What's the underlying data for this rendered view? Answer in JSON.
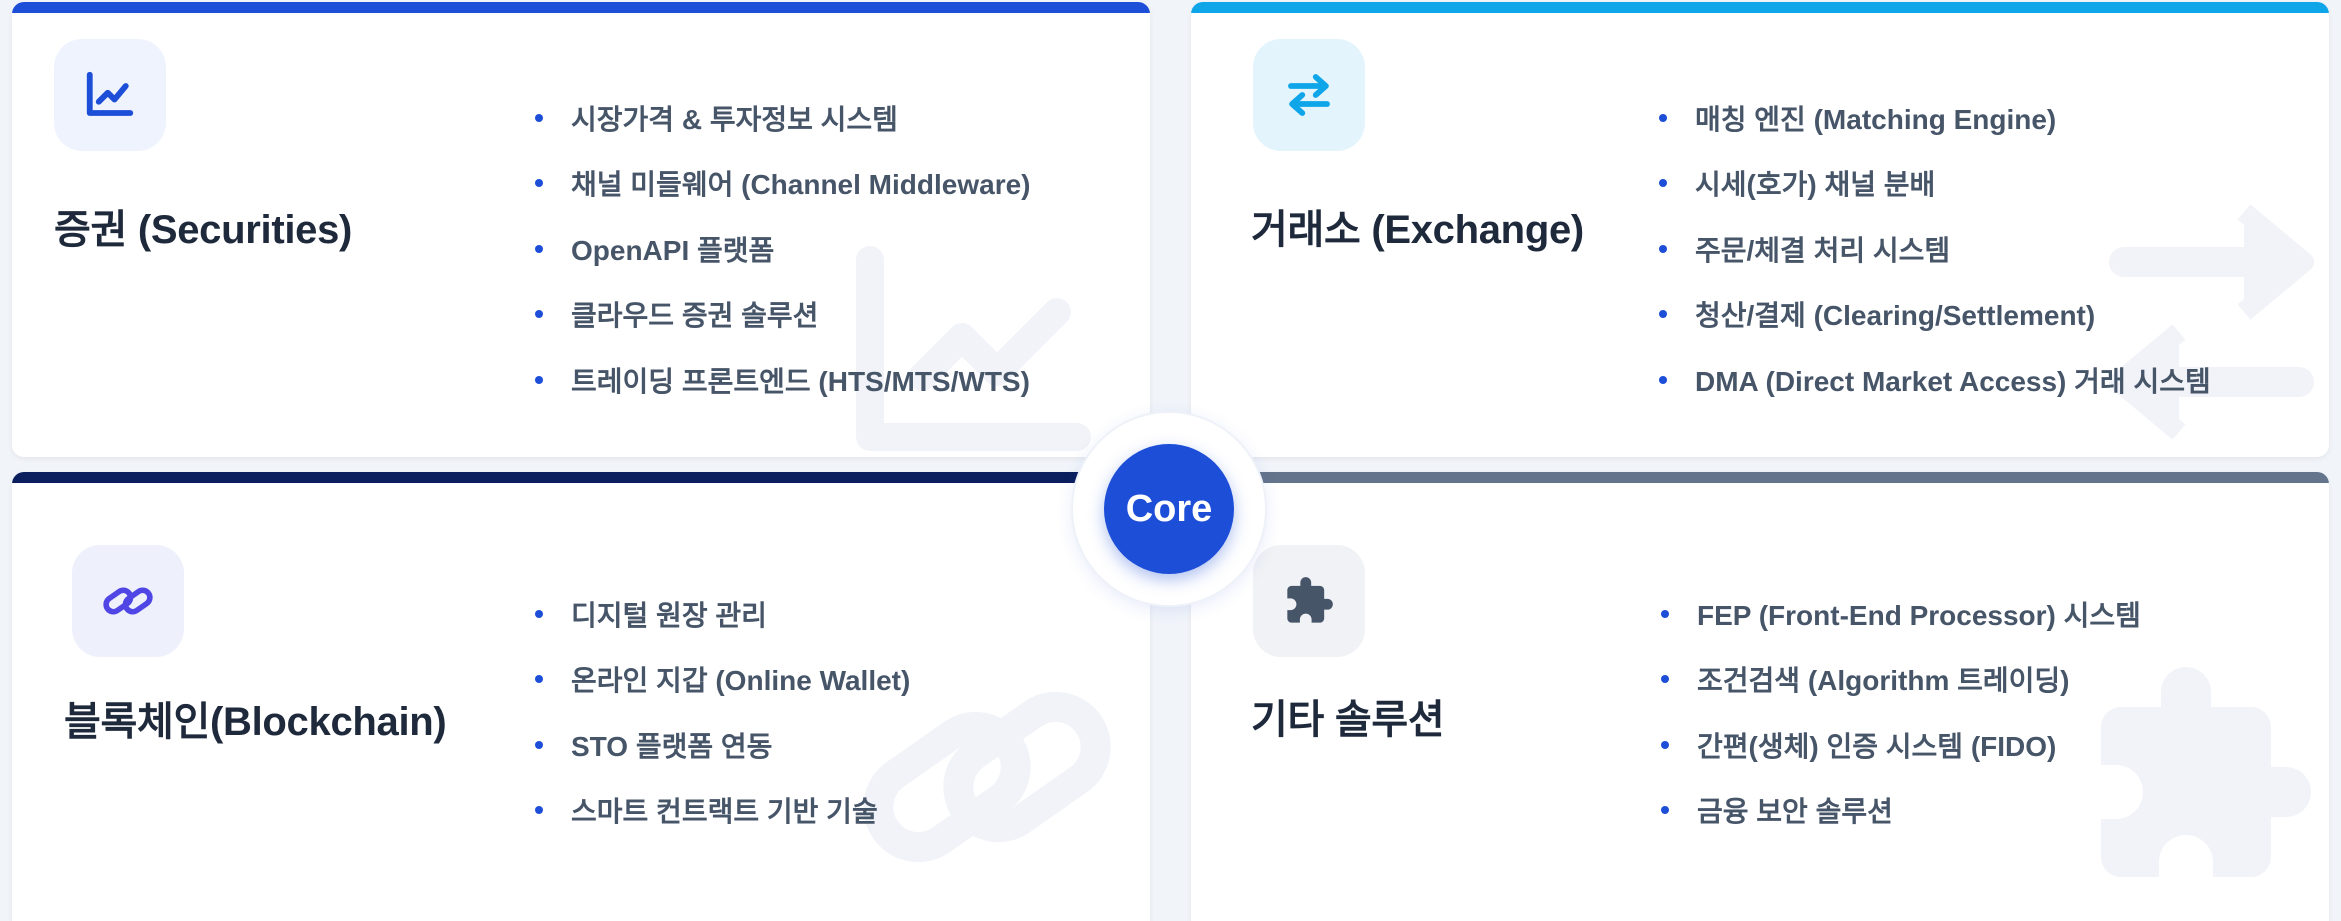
{
  "colors": {
    "securities_accent": "#1d4ed8",
    "exchange_accent": "#0ea5e9",
    "blockchain_accent": "#0b1f5e",
    "other_accent": "#64748b",
    "core_badge": "#1d4ed8"
  },
  "quadrants": {
    "securities": {
      "icon": "chart-line-icon",
      "title": "증권 (Securities)",
      "items": [
        "시장가격 & 투자정보 시스템",
        "채널 미들웨어 (Channel Middleware)",
        "OpenAPI 플랫폼",
        "클라우드 증권 솔루션",
        "트레이딩 프론트엔드 (HTS/MTS/WTS)"
      ]
    },
    "exchange": {
      "icon": "exchange-arrows-icon",
      "title": "거래소 (Exchange)",
      "items": [
        "매칭 엔진 (Matching Engine)",
        "시세(호가) 채널 분배",
        "주문/체결 처리 시스템",
        "청산/결제 (Clearing/Settlement)",
        "DMA (Direct Market Access) 거래 시스템"
      ]
    },
    "blockchain": {
      "icon": "link-icon",
      "title": "블록체인(Blockchain)",
      "items": [
        "디지털 원장 관리",
        "온라인 지갑 (Online Wallet)",
        "STO 플랫폼 연동",
        "스마트 컨트랙트 기반 기술"
      ]
    },
    "other": {
      "icon": "puzzle-icon",
      "title": "기타 솔루션",
      "items": [
        "FEP (Front-End Processor) 시스템",
        "조건검색 (Algorithm 트레이딩)",
        "간편(생체) 인증 시스템 (FIDO)",
        "금융 보안 솔루션"
      ]
    }
  },
  "center": {
    "label": "Core"
  }
}
